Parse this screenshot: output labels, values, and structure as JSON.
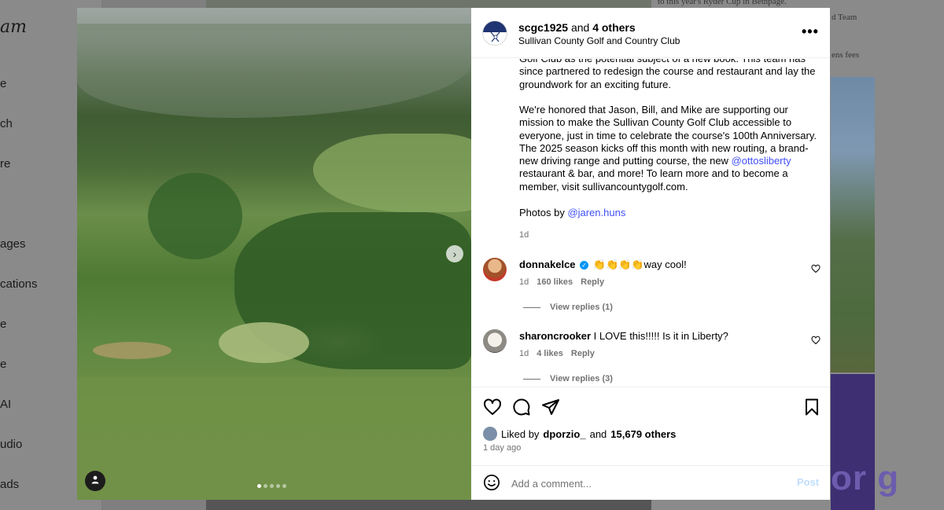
{
  "background": {
    "logo": "am",
    "nav_items": [
      "e",
      "ch",
      "re",
      "ages",
      "cations",
      "e",
      "e",
      "AI",
      "udio",
      "ads"
    ],
    "article_lines": [
      "to this year's Ryder Cup in Bethpage.",
      "d Team",
      "ens fees"
    ],
    "article_big_text": "or g"
  },
  "post": {
    "author": {
      "username": "scgc1925",
      "connector": " and ",
      "others": "4 others",
      "subtitle": "Sullivan County Golf and Country Club"
    },
    "more_label": "•••",
    "caption": {
      "para1": "Golf Club as the potential subject of a new book. This team has since partnered to redesign the course and restaurant and lay the groundwork for an exciting future.",
      "para2_before": "We're honored that Jason, Bill, and Mike are supporting our mission to make the Sullivan County Golf Club accessible to everyone, just in time to celebrate the course's 100th Anniversary. The 2025 season kicks off this month with new routing, a brand-new driving range and putting course, the new ",
      "para2_mention": "@ottosliberty",
      "para2_after": " restaurant & bar, and more! To learn more and to become a member, visit sullivancountygolf.com.",
      "para3_before": "Photos by ",
      "para3_mention": "@jaren.huns",
      "time": "1d"
    },
    "comments": [
      {
        "username": "donnakelce",
        "verified_mark": "✓",
        "text": "👏👏👏👏way cool!",
        "time": "1d",
        "likes": "160 likes",
        "reply_label": "Reply",
        "view_replies": "View replies (1)"
      },
      {
        "username": "sharoncrooker",
        "text": "I LOVE this!!!!! Is it in Liberty?",
        "time": "1d",
        "likes": "4 likes",
        "reply_label": "Reply",
        "view_replies": "View replies (3)"
      }
    ],
    "likes": {
      "prefix": "Liked by",
      "user": "dporzio_",
      "connector": "and",
      "others": "15,679 others"
    },
    "time_ago": "1 day ago",
    "comment_placeholder": "Add a comment...",
    "post_label": "Post",
    "carousel": {
      "total": 5,
      "active": 1
    },
    "next_arrow": "›"
  },
  "colors": {
    "link": "#4150f7",
    "post_disabled": "#c0dffd",
    "verified": "#0095f6",
    "meta": "#737373"
  },
  "icons": [
    "heart-icon",
    "comment-icon",
    "share-icon",
    "bookmark-icon",
    "emoji-icon",
    "user-tag-icon",
    "chevron-right-icon",
    "more-icon"
  ]
}
